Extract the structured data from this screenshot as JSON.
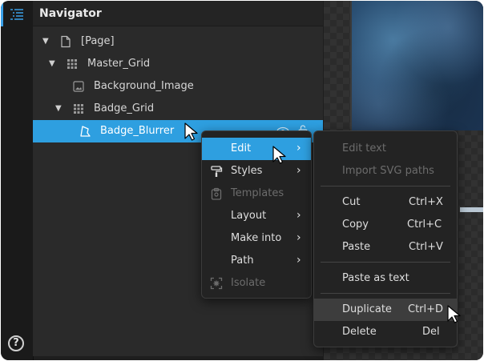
{
  "navigator": {
    "title": "Navigator",
    "tree": [
      {
        "label": "[Page]"
      },
      {
        "label": "Master_Grid"
      },
      {
        "label": "Background_Image"
      },
      {
        "label": "Badge_Grid"
      },
      {
        "label": "Badge_Blurrer"
      }
    ]
  },
  "help": {
    "label": "?"
  },
  "context_menu": {
    "items": [
      {
        "label": "Edit"
      },
      {
        "label": "Styles"
      },
      {
        "label": "Templates"
      },
      {
        "label": "Layout"
      },
      {
        "label": "Make into"
      },
      {
        "label": "Path"
      },
      {
        "label": "Isolate"
      }
    ]
  },
  "edit_submenu": {
    "items": [
      {
        "label": "Edit text",
        "shortcut": ""
      },
      {
        "label": "Import SVG paths",
        "shortcut": ""
      },
      {
        "label": "Cut",
        "shortcut": "Ctrl+X"
      },
      {
        "label": "Copy",
        "shortcut": "Ctrl+C"
      },
      {
        "label": "Paste",
        "shortcut": "Ctrl+V"
      },
      {
        "label": "Paste as text",
        "shortcut": ""
      },
      {
        "label": "Duplicate",
        "shortcut": "Ctrl+D"
      },
      {
        "label": "Delete",
        "shortcut": "Del"
      }
    ]
  },
  "colors": {
    "accent": "#2e9fe0",
    "panel": "#2a2a2a",
    "menu": "#232323"
  }
}
